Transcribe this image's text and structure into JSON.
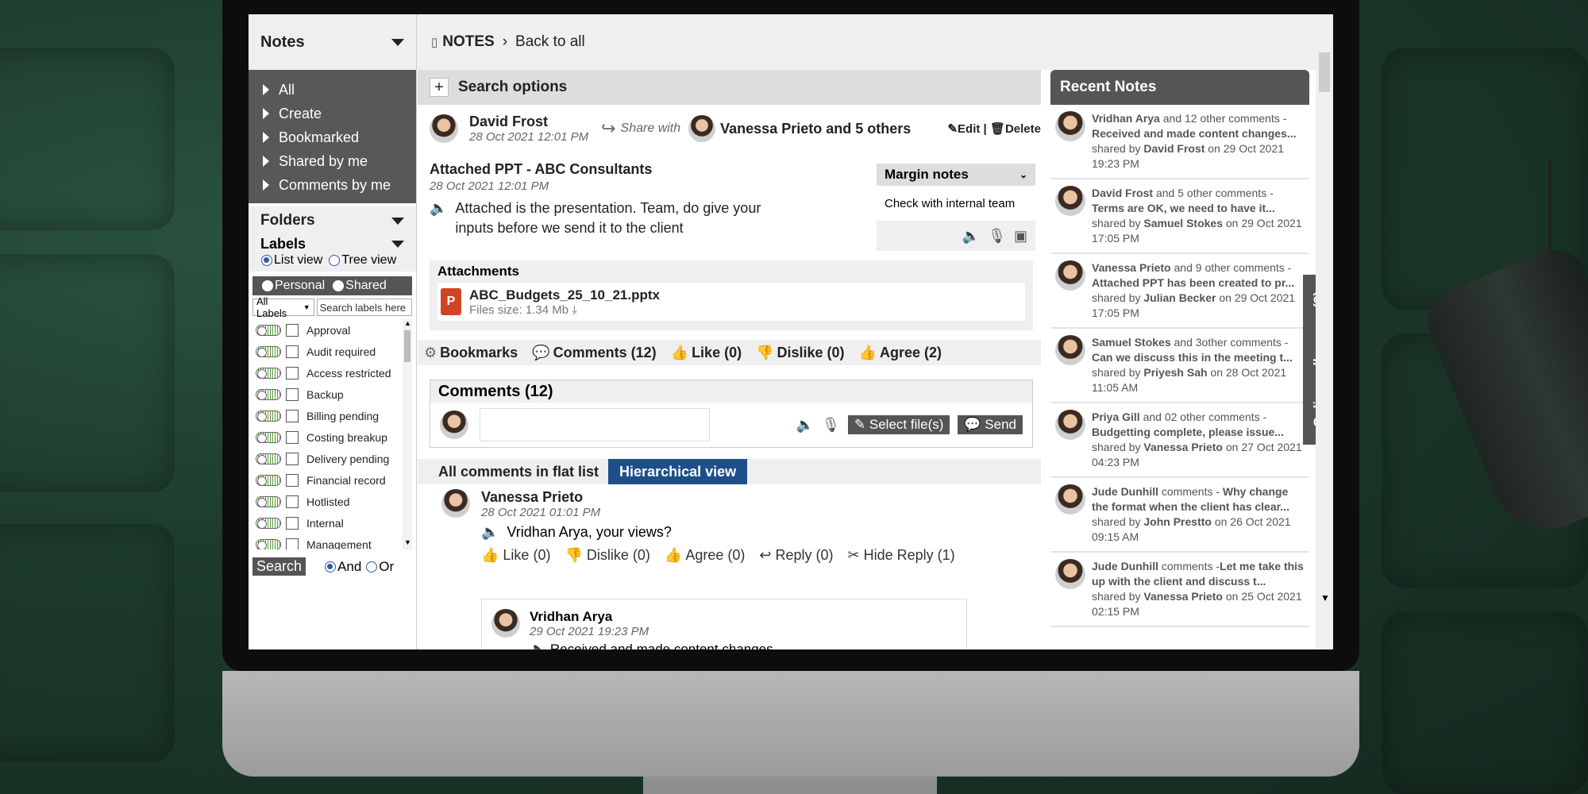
{
  "sidebar": {
    "notes_title": "Notes",
    "menu": [
      "All",
      "Create",
      "Bookmarked",
      "Shared by me",
      "Comments by me"
    ],
    "folders_title": "Folders",
    "labels_title": "Labels",
    "list_view": "List view",
    "tree_view": "Tree view",
    "personal": "Personal",
    "shared": "Shared",
    "all_labels": "All Labels",
    "search_labels_placeholder": "Search labels here",
    "labels": [
      "Approval",
      "Audit required",
      "Access restricted",
      "Backup",
      "Billing pending",
      "Costing breakup",
      "Delivery pending",
      "Financial record",
      "Hotlisted",
      "Internal",
      "Management"
    ],
    "search_button": "Search",
    "and_label": "And",
    "or_label": "Or"
  },
  "topbar": {
    "section": "NOTES",
    "separator": "›",
    "back": "Back to all"
  },
  "main": {
    "search_options": "Search options",
    "author": "David Frost",
    "author_date": "28 Oct 2021 12:01 PM",
    "share_with": "Share with",
    "shared_with": "Vanessa Prieto and 5 others",
    "edit": "Edit",
    "delete": "Delete",
    "post_title": "Attached PPT - ABC Consultants",
    "post_date": "28 Oct 2021 12:01 PM",
    "post_body": "Attached is the presentation. Team, do give your inputs before we send it to the client",
    "margin_notes_title": "Margin notes",
    "margin_note": "Check with internal team",
    "attachments_title": "Attachments",
    "file_name": "ABC_Budgets_25_10_21.pptx",
    "file_size": "Files size: 1.34 Mb",
    "bookmarks": "Bookmarks",
    "comments_tab": "Comments (12)",
    "like": "Like (0)",
    "dislike": "Dislike (0)",
    "agree": "Agree (2)",
    "comments_header": "Comments (12)",
    "select_files": "Select file(s)",
    "send": "Send",
    "flat_list": "All comments in flat list",
    "hierarchical": "Hierarchical view",
    "comment": {
      "name": "Vanessa Prieto",
      "date": "28 Oct 2021 01:01 PM",
      "text": "Vridhan Arya, your views?",
      "like": "Like (0)",
      "dislike": "Dislike (0)",
      "agree": "Agree (0)",
      "reply": "Reply (0)",
      "hide_reply": "Hide Reply (1)"
    },
    "reply": {
      "name": "Vridhan Arya",
      "date": "29 Oct 2021 19:23 PM",
      "text": "Received and made content changes."
    }
  },
  "recent": {
    "title": "Recent Notes",
    "items": [
      {
        "who": "Vridhan Arya",
        "mid": " and 12 other comments - ",
        "what": "Received and made content changes...",
        "by": "David Frost",
        "when": " on 29 Oct 2021 19:23 PM"
      },
      {
        "who": "David Frost",
        "mid": " and 5 other comments - ",
        "what": "Terms are OK, we need to have it...",
        "by": "Samuel Stokes",
        "when": " on 29 Oct 2021 17:05 PM"
      },
      {
        "who": "Vanessa Prieto",
        "mid": " and 9 other comments - ",
        "what": "Attached PPT has been created to pr...",
        "by": "Julian Becker",
        "when": " on 29 Oct 2021 17:05 PM"
      },
      {
        "who": "Samuel Stokes",
        "mid": " and 3other comments - ",
        "what": "Can we discuss this in the meeting t...",
        "by": "Priyesh Sah",
        "when": " on 28 Oct 2021 11:05 AM"
      },
      {
        "who": "Priya Gill",
        "mid": " and 02 other comments - ",
        "what": "Budgetting complete, please issue...",
        "by": "Vanessa Prieto",
        "when": " on 27 Oct 2021 04:23 PM"
      },
      {
        "who": "Jude Dunhill",
        "mid": " comments - ",
        "what": "Why change the format when the client has clear...",
        "by": "John Prestto",
        "when": " on 26 Oct 2021 09:15 AM"
      },
      {
        "who": "Jude Dunhill",
        "mid": " comments -",
        "what": "Let me take this up with the client and discuss t...",
        "by": "Vanessa Prieto",
        "when": " on 25 Oct 2021 02:15 PM"
      }
    ],
    "shared_by": "shared by ",
    "online_colleagues": "Online colleagues (2)"
  }
}
